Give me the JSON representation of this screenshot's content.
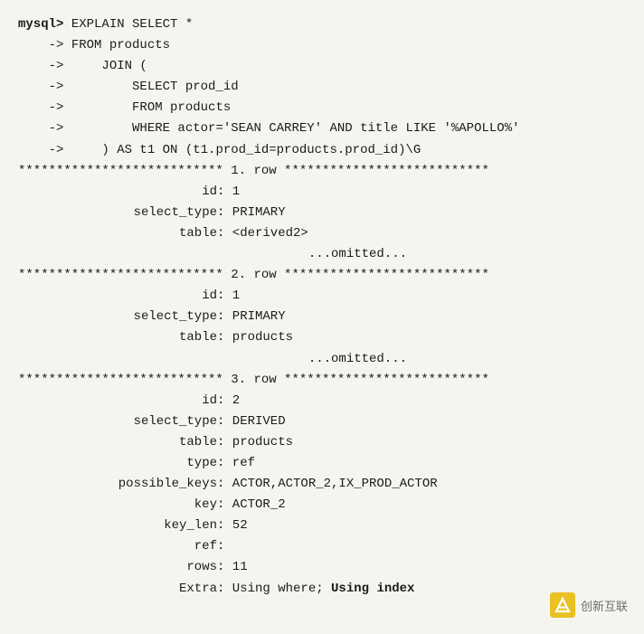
{
  "terminal": {
    "prompt": "mysql>",
    "continuation": "    ->",
    "query_lines": [
      {
        "prefix": "mysql> ",
        "content": "EXPLAIN SELECT *"
      },
      {
        "prefix": "    -> ",
        "content": "FROM products"
      },
      {
        "prefix": "    -> ",
        "content": "    JOIN ("
      },
      {
        "prefix": "    -> ",
        "content": "        SELECT prod_id"
      },
      {
        "prefix": "    -> ",
        "content": "        FROM products"
      },
      {
        "prefix": "    -> ",
        "content": "        WHERE actor='SEAN CARREY' AND title LIKE '%APOLLO%'"
      },
      {
        "prefix": "    -> ",
        "content": "    ) AS t1 ON (t1.prod_id=products.prod_id)\\G"
      }
    ],
    "separator_star": "*************************** ",
    "rows": [
      {
        "number": "1",
        "label": "row",
        "fields": [
          {
            "label": "id",
            "value": "1"
          },
          {
            "label": "select_type",
            "value": "PRIMARY"
          },
          {
            "label": "table",
            "value": "<derived2>"
          },
          {
            "label": "...",
            "value": "omitted..."
          }
        ]
      },
      {
        "number": "2",
        "label": "row",
        "fields": [
          {
            "label": "id",
            "value": "1"
          },
          {
            "label": "select_type",
            "value": "PRIMARY"
          },
          {
            "label": "table",
            "value": "products"
          },
          {
            "label": "...",
            "value": "omitted..."
          }
        ]
      },
      {
        "number": "3",
        "label": "row",
        "fields": [
          {
            "label": "id",
            "value": "2"
          },
          {
            "label": "select_type",
            "value": "DERIVED"
          },
          {
            "label": "table",
            "value": "products"
          },
          {
            "label": "type",
            "value": "ref"
          },
          {
            "label": "possible_keys",
            "value": "ACTOR,ACTOR_2,IX_PROD_ACTOR"
          },
          {
            "label": "key",
            "value": "ACTOR_2"
          },
          {
            "label": "key_len",
            "value": "52"
          },
          {
            "label": "ref",
            "value": ""
          },
          {
            "label": "rows",
            "value": "11"
          },
          {
            "label": "Extra",
            "value": "Using where; Using index"
          }
        ]
      }
    ]
  },
  "watermark": {
    "text": "创新互联"
  }
}
